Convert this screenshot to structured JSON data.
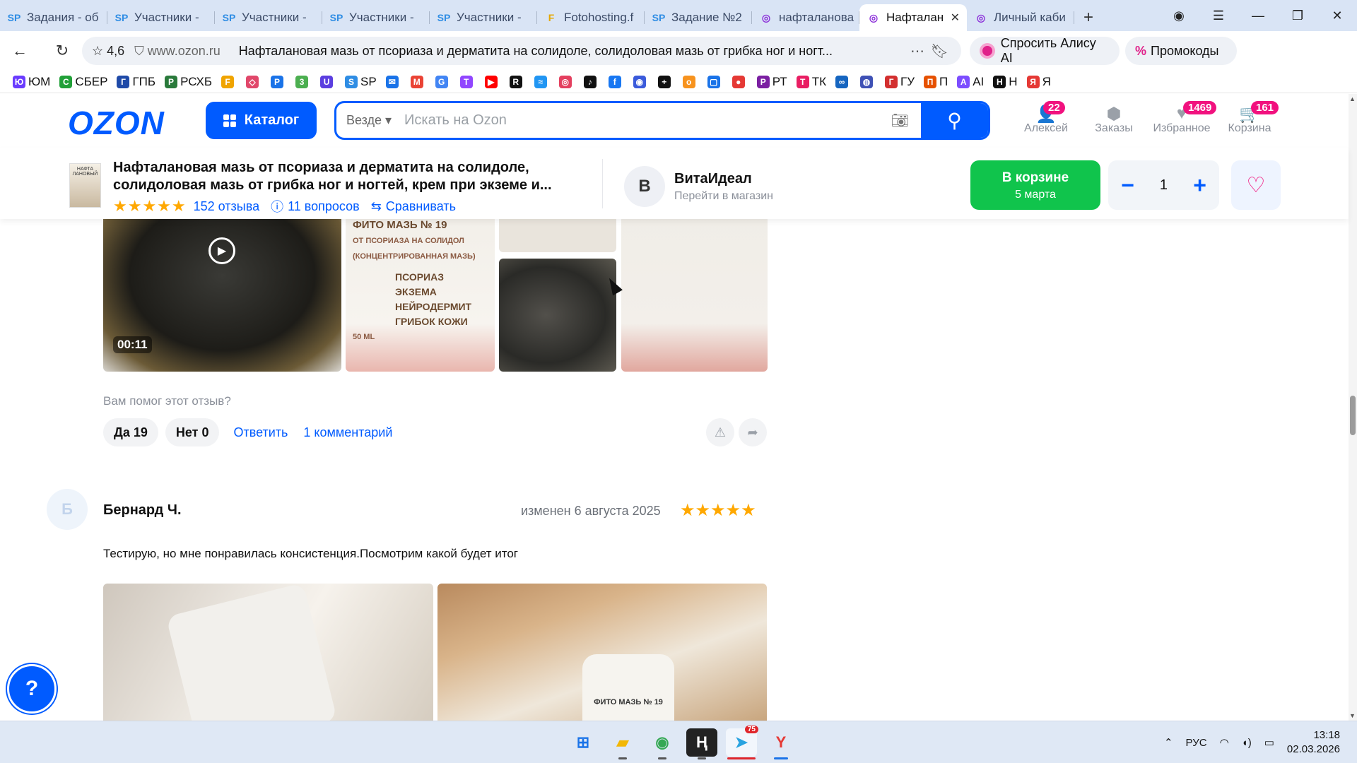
{
  "browser": {
    "tabs": [
      {
        "icon": "SP",
        "icon_color": "#2f8de4",
        "title": "Задания - об"
      },
      {
        "icon": "SP",
        "icon_color": "#2f8de4",
        "title": "Участники - "
      },
      {
        "icon": "SP",
        "icon_color": "#2f8de4",
        "title": "Участники - "
      },
      {
        "icon": "SP",
        "icon_color": "#2f8de4",
        "title": "Участники - "
      },
      {
        "icon": "SP",
        "icon_color": "#2f8de4",
        "title": "Участники - "
      },
      {
        "icon": "F",
        "icon_color": "#e5a800",
        "title": "Fotohosting.f"
      },
      {
        "icon": "SP",
        "icon_color": "#2f8de4",
        "title": "Задание №2"
      },
      {
        "icon": "◎",
        "icon_color": "#8b2fd9",
        "title": "нафталанова"
      },
      {
        "icon": "◎",
        "icon_color": "#8b2fd9",
        "title": "Нафталан",
        "active": true
      },
      {
        "icon": "◎",
        "icon_color": "#8b2fd9",
        "title": "Личный каби"
      }
    ],
    "site_rating": "4,6",
    "domain": "www.ozon.ru",
    "page_title": "Нафталановая мазь от псориаза и дерматита на солидоле, солидоловая мазь от грибка ног и ногт...",
    "alice_button": "Спросить Алису AI",
    "promo_button": "Промокоды",
    "bookmarks": [
      {
        "label": "ЮМ",
        "color": "#6a3cff",
        "glyph": "Ю"
      },
      {
        "label": "СБЕР",
        "color": "#21a038",
        "glyph": "С"
      },
      {
        "label": "ГПБ",
        "color": "#1f4aa8",
        "glyph": "Г"
      },
      {
        "label": "РСХБ",
        "color": "#2a7a3b",
        "glyph": "Р"
      },
      {
        "label": "",
        "color": "#f0a400",
        "glyph": "F"
      },
      {
        "label": "",
        "color": "#e1476a",
        "glyph": "◇"
      },
      {
        "label": "",
        "color": "#1a73e8",
        "glyph": "P"
      },
      {
        "label": "",
        "color": "#4caf50",
        "glyph": "3"
      },
      {
        "label": "",
        "color": "#5b3ee0",
        "glyph": "U"
      },
      {
        "label": "SP",
        "color": "#2f8de4",
        "glyph": "S"
      },
      {
        "label": "",
        "color": "#1a73e8",
        "glyph": "✉"
      },
      {
        "label": "",
        "color": "#ea4335",
        "glyph": "M"
      },
      {
        "label": "",
        "color": "#4285f4",
        "glyph": "G"
      },
      {
        "label": "",
        "color": "#9146ff",
        "glyph": "T"
      },
      {
        "label": "",
        "color": "#ff0000",
        "glyph": "▶"
      },
      {
        "label": "",
        "color": "#111111",
        "glyph": "R"
      },
      {
        "label": "",
        "color": "#2196f3",
        "glyph": "≈"
      },
      {
        "label": "",
        "color": "#e4405f",
        "glyph": "◎"
      },
      {
        "label": "",
        "color": "#111111",
        "glyph": "♪"
      },
      {
        "label": "",
        "color": "#1877f2",
        "glyph": "f"
      },
      {
        "label": "",
        "color": "#3b5bdb",
        "glyph": "◉"
      },
      {
        "label": "",
        "color": "#111111",
        "glyph": "+"
      },
      {
        "label": "",
        "color": "#f7931e",
        "glyph": "о"
      },
      {
        "label": "",
        "color": "#1a73e8",
        "glyph": "▢"
      },
      {
        "label": "",
        "color": "#e53935",
        "glyph": "●"
      },
      {
        "label": "РТ",
        "color": "#7b1fa2",
        "glyph": "Р"
      },
      {
        "label": "ТК",
        "color": "#e91e63",
        "glyph": "Т"
      },
      {
        "label": "",
        "color": "#1565c0",
        "glyph": "∞"
      },
      {
        "label": "",
        "color": "#3f51b5",
        "glyph": "◍"
      },
      {
        "label": "ГУ",
        "color": "#d32f2f",
        "glyph": "Г"
      },
      {
        "label": "П",
        "color": "#e65100",
        "glyph": "П"
      },
      {
        "label": "AI",
        "color": "#7c4dff",
        "glyph": "A"
      },
      {
        "label": "Н",
        "color": "#111111",
        "glyph": "Н"
      },
      {
        "label": "Я",
        "color": "#e53935",
        "glyph": "Я"
      }
    ]
  },
  "ozon": {
    "logo": "OZON",
    "catalog_label": "Каталог",
    "search_scope": "Везде",
    "search_placeholder": "Искать на Ozon",
    "header_items": [
      {
        "label": "Алексей",
        "badge": "22",
        "icon": "user-icon",
        "glyph": "👤"
      },
      {
        "label": "Заказы",
        "badge": "",
        "icon": "box-icon",
        "glyph": "⬢"
      },
      {
        "label": "Избранное",
        "badge": "1469",
        "icon": "heart-icon",
        "glyph": "♥"
      },
      {
        "label": "Корзина",
        "badge": "161",
        "icon": "cart-icon",
        "glyph": "🛒"
      }
    ]
  },
  "product": {
    "title": "Нафталановая мазь от псориаза и дерматита на солидоле, солидоловая мазь от грибка ног и ногтей, крем при экземе и...",
    "thumb_label": "НАФТА ЛАНОВЫЙ",
    "stars": "★★★★★",
    "reviews_link": "152 отзыва",
    "questions_link": "11 вопросов",
    "compare_link": "Сравнивать",
    "seller_initial": "В",
    "seller_name": "ВитаИдеал",
    "seller_link": "Перейти в магазин",
    "cart_status": "В корзине",
    "cart_date": "5 марта",
    "quantity": "1"
  },
  "review1": {
    "video_duration": "00:11",
    "label_photo_text": "ФИТО МАЗЬ № 19",
    "label_photo_sub": "ОТ ПСОРИАЗА НА СОЛИДОЛ",
    "label_photo_sub2": "(КОНЦЕНТРИРОВАННАЯ МАЗЬ)",
    "label_items": [
      "ПСОРИАЗ",
      "ЭКЗЕМА",
      "НЕЙРОДЕРМИТ",
      "ГРИБОК КОЖИ"
    ],
    "label_volume": "50 ML",
    "helped_question": "Вам помог этот отзыв?",
    "yes_label": "Да 19",
    "no_label": "Нет 0",
    "reply_link": "Ответить",
    "comments_link": "1 комментарий"
  },
  "review2": {
    "avatar_initial": "Б",
    "author": "Бернард Ч.",
    "date": "изменен 6 августа 2025",
    "stars": "★★★★★",
    "text": "Тестирую, но мне понравилась консистенция.Посмотрим какой будет итог",
    "jar_label": "ФИТО МАЗЬ № 19"
  },
  "help_button": "?",
  "taskbar": {
    "telegram_badge": "75",
    "lang": "РУС",
    "time": "13:18",
    "date": "02.03.2026"
  }
}
